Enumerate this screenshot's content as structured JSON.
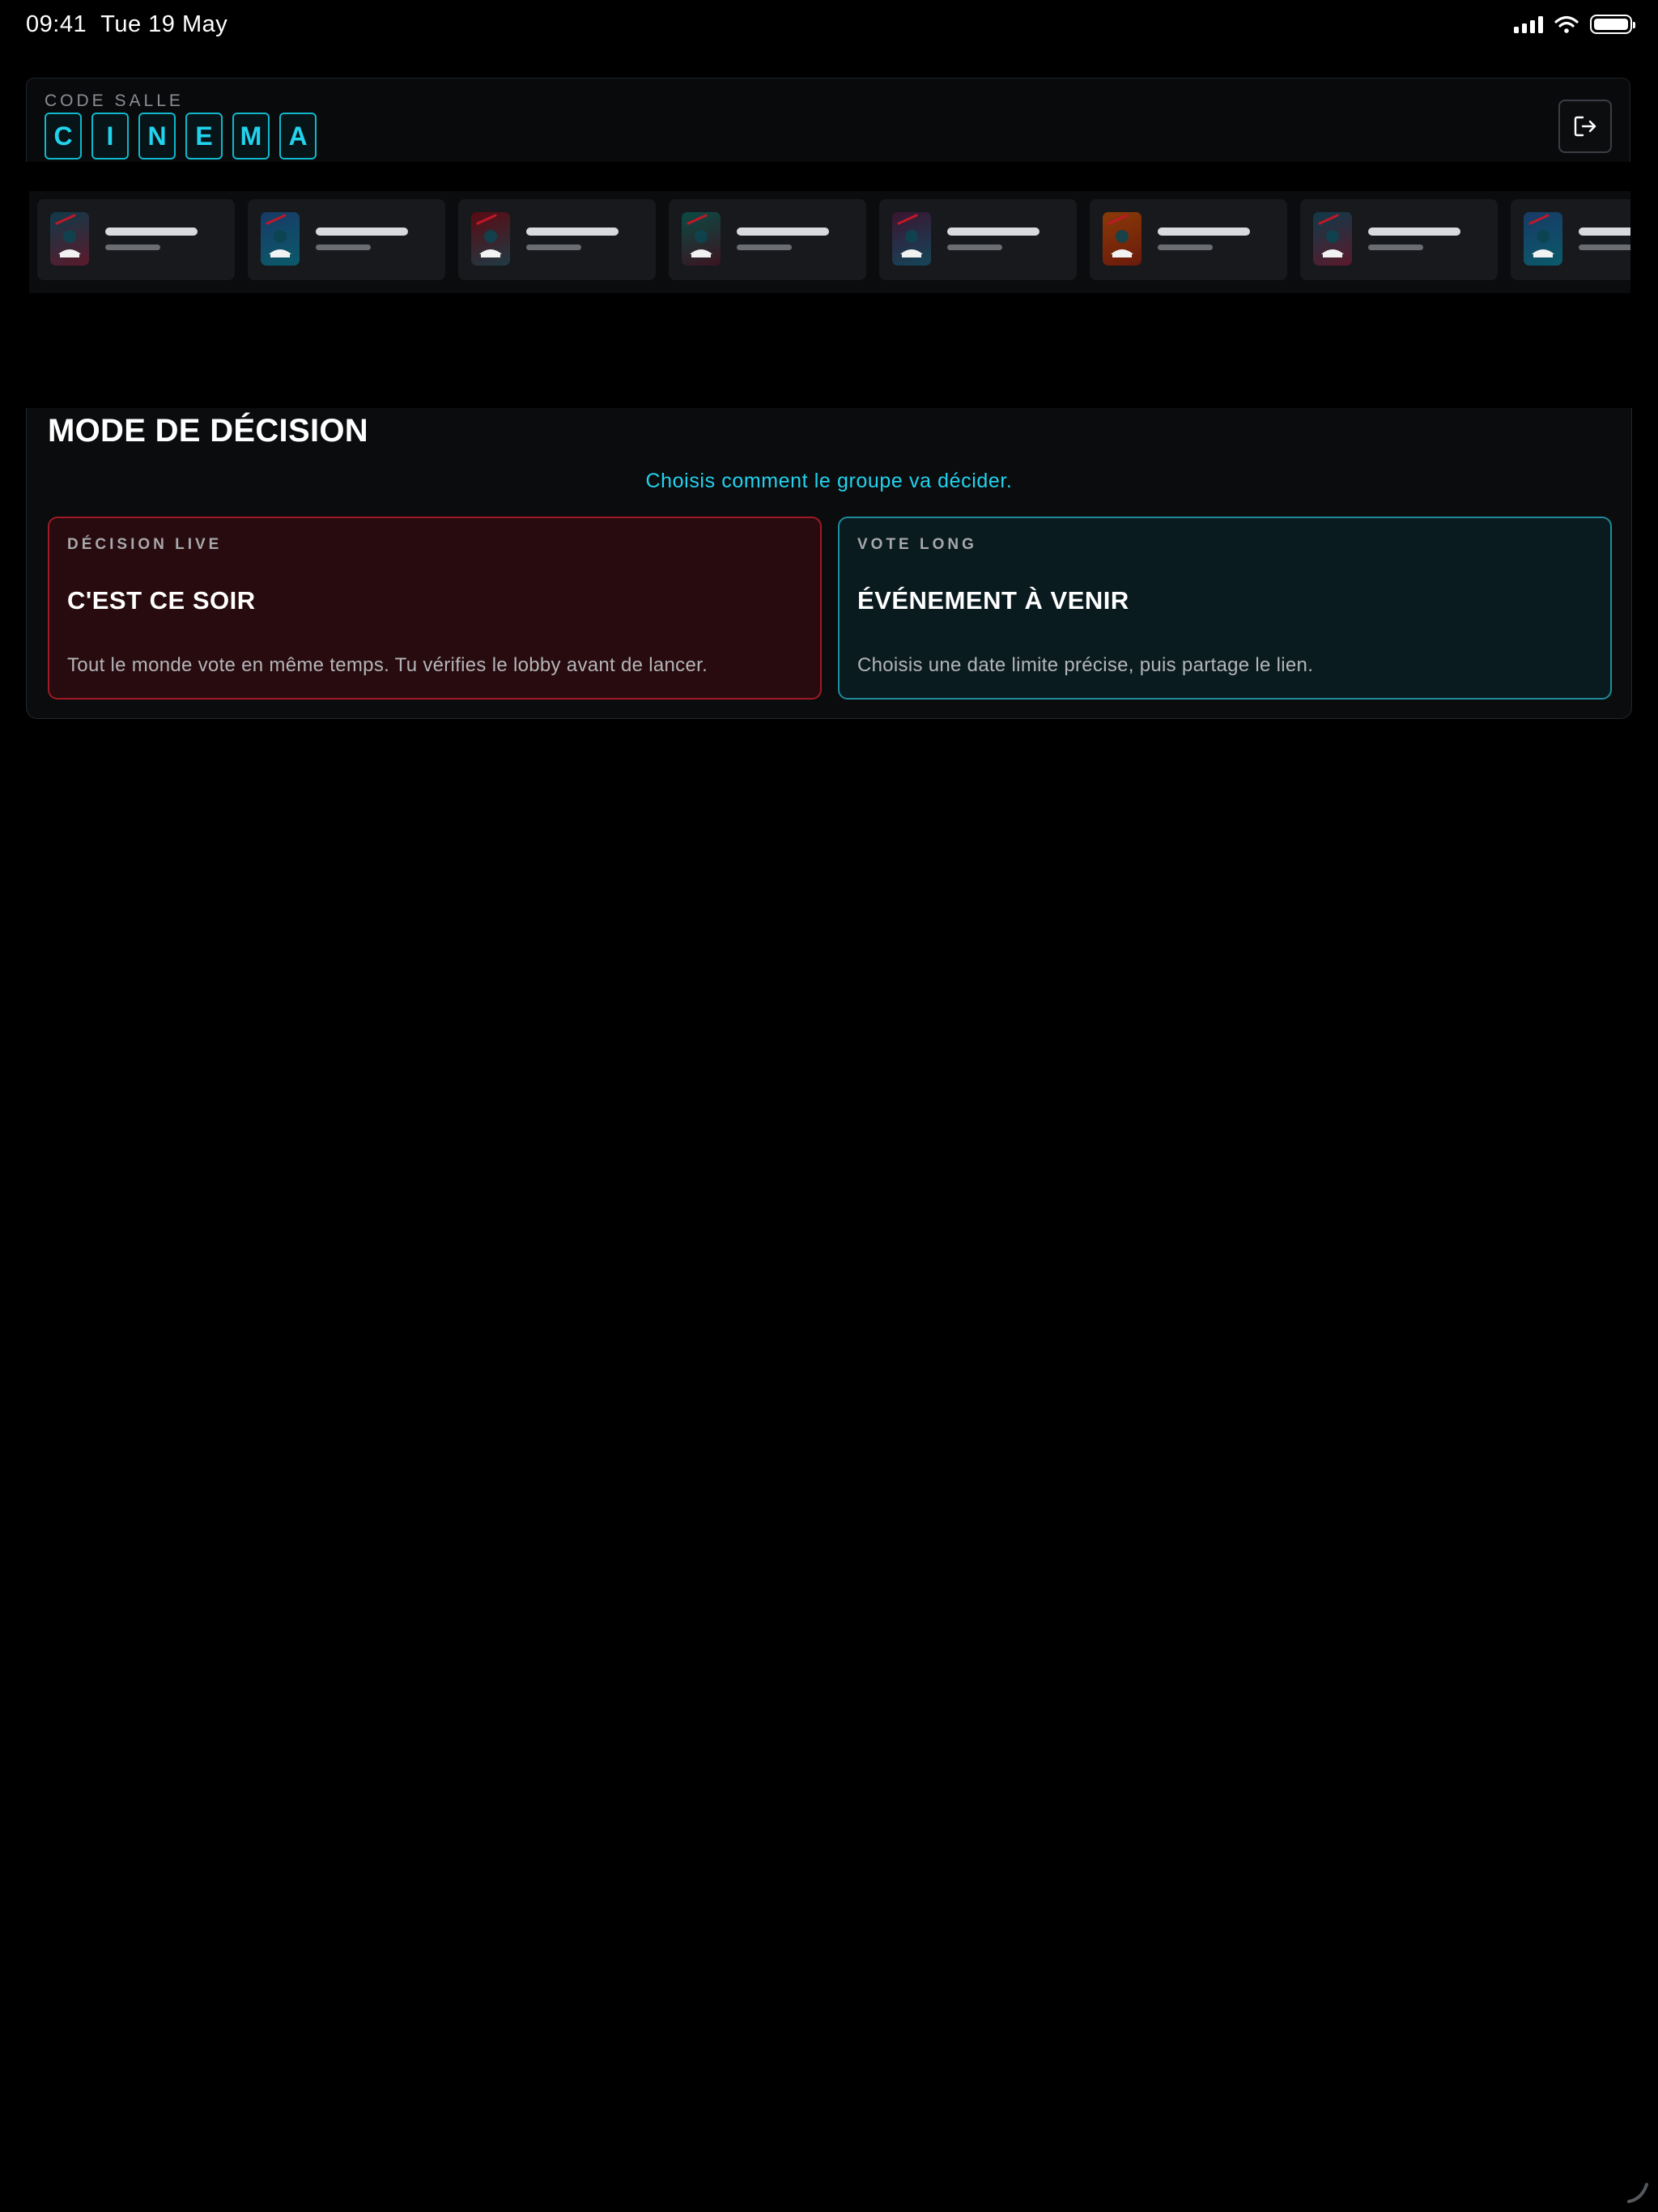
{
  "status_bar": {
    "time": "09:41",
    "date": "Tue 19 May"
  },
  "header": {
    "code_label": "CODE SALLE",
    "code_letters": [
      "C",
      "I",
      "N",
      "E",
      "M",
      "A"
    ],
    "logout_icon": "logout-icon"
  },
  "carousel": {
    "poster_gradients": [
      [
        "#0f3a4a",
        "#5a1a2a"
      ],
      [
        "#173a66",
        "#0b5a6a"
      ],
      [
        "#5a0a12",
        "#1f3a44"
      ],
      [
        "#0b4a44",
        "#3a1420"
      ],
      [
        "#3a1430",
        "#14465a"
      ],
      [
        "#8a3a08",
        "#6a1a0a"
      ],
      [
        "#0f3a4a",
        "#5a1a2a"
      ],
      [
        "#173a66",
        "#0b5a6a"
      ]
    ]
  },
  "decision": {
    "title": "MODE DE DÉCISION",
    "subtitle": "Choisis comment le groupe va décider.",
    "modes": [
      {
        "kicker": "DÉCISION LIVE",
        "title": "C'EST CE SOIR",
        "description": "Tout le monde vote en même temps. Tu vérifies le lobby avant de lancer."
      },
      {
        "kicker": "VOTE LONG",
        "title": "ÉVÉNEMENT À VENIR",
        "description": "Choisis une date limite précise, puis partage le lien."
      }
    ]
  },
  "colors": {
    "accent_cyan": "#22d3ee",
    "live_border": "#9f1a24",
    "long_border": "#1f8c9c"
  }
}
